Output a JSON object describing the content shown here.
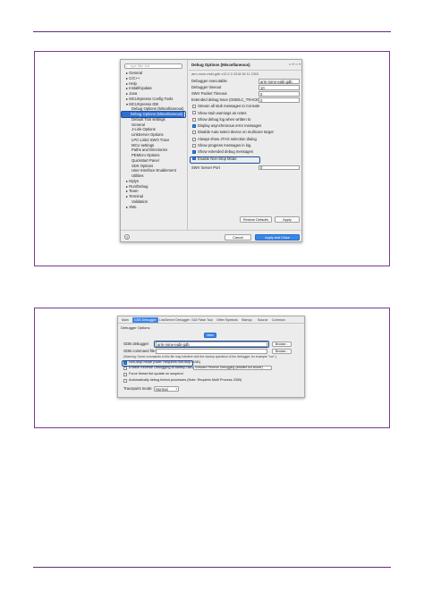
{
  "prefs": {
    "filter_placeholder": "type filter text",
    "tree": [
      {
        "label": "▸ General",
        "indent": 0,
        "selected": false
      },
      {
        "label": "▸ C/C++",
        "indent": 0,
        "selected": false
      },
      {
        "label": "▸ Help",
        "indent": 0,
        "selected": false
      },
      {
        "label": "▸ Install/Update",
        "indent": 0,
        "selected": false
      },
      {
        "label": "▸ Java",
        "indent": 0,
        "selected": false
      },
      {
        "label": "▸ MCUXpresso Config Tools",
        "indent": 0,
        "selected": false
      },
      {
        "label": "▾ MCUXpresso IDE",
        "indent": 0,
        "selected": false
      },
      {
        "label": "Debug Options (Miscellaneous)",
        "indent": 1,
        "selected": false
      },
      {
        "label": "Debug Options (Miscellaneous)",
        "indent": 1,
        "selected": true
      },
      {
        "label": "Default Tool settings",
        "indent": 1,
        "selected": false
      },
      {
        "label": "General",
        "indent": 1,
        "selected": false
      },
      {
        "label": "J-Link Options",
        "indent": 1,
        "selected": false
      },
      {
        "label": "LinkServer Options",
        "indent": 1,
        "selected": false
      },
      {
        "label": "LPC-Link2 SWO Trace",
        "indent": 1,
        "selected": false
      },
      {
        "label": "MCU settings",
        "indent": 1,
        "selected": false
      },
      {
        "label": "Paths and Directories",
        "indent": 1,
        "selected": false
      },
      {
        "label": "PEMicro Options",
        "indent": 1,
        "selected": false
      },
      {
        "label": "Quickstart Panel",
        "indent": 1,
        "selected": false
      },
      {
        "label": "SDK Options",
        "indent": 1,
        "selected": false
      },
      {
        "label": "User Interface Enablement",
        "indent": 1,
        "selected": false
      },
      {
        "label": "Utilities",
        "indent": 1,
        "selected": false
      },
      {
        "label": "▸ Mylyn",
        "indent": 0,
        "selected": false
      },
      {
        "label": "▸ Run/Debug",
        "indent": 0,
        "selected": false
      },
      {
        "label": "▸ Team",
        "indent": 0,
        "selected": false
      },
      {
        "label": "▸ Terminal",
        "indent": 0,
        "selected": false
      },
      {
        "label": "Validation",
        "indent": 1,
        "selected": false
      },
      {
        "label": "▸ XML",
        "indent": 0,
        "selected": false
      }
    ],
    "panel_title": "Debug Options (Miscellaneous)",
    "nav_glyphs": "⇦ ▾ ⇨ ▾",
    "subtitle": "arm-none-eabi-gdb v10.2.0 2018 06 11 2303",
    "fields": [
      {
        "label": "Debugger executable",
        "value": "arm-none-eabi-gdb"
      },
      {
        "label": "Debugger timeout",
        "value": "10"
      },
      {
        "label": "SWV Packet Timeout",
        "value": "0"
      },
      {
        "label": "Extended debug trace (0GB/LC_TRACE)",
        "value": "0"
      }
    ],
    "checks": [
      {
        "label": "Stream all stub messages to Console",
        "checked": false
      },
      {
        "label": "Show stub warnings as notes",
        "checked": false
      },
      {
        "label": "Show debug log when written to",
        "checked": false
      },
      {
        "label": "Display asynchronous error messages",
        "checked": true
      },
      {
        "label": "Disable Auto select device on multicore target",
        "checked": false
      },
      {
        "label": "Always show JTAG selection dialog",
        "checked": false
      },
      {
        "label": "Show progress messages in log",
        "checked": false
      },
      {
        "label": "Show extended debug messages",
        "checked": true
      },
      {
        "label": "Enable Non-Stop Mode",
        "checked": true
      }
    ],
    "server_port_label": "SWV Server Port",
    "server_port_value": "0",
    "restore_defaults": "Restore Defaults",
    "apply": "Apply",
    "cancel": "Cancel",
    "apply_close": "Apply and Close"
  },
  "launch": {
    "tabs": [
      "Main",
      "GDB Debugger",
      "LinkServer Debugger",
      "GUI Flash Tool",
      "Other Symbols",
      "Startup",
      "Source",
      "Common"
    ],
    "selected_tab": 1,
    "section_title": "Debugger Options",
    "main_button": "Main",
    "gdb_debugger_label": "GDB debugger:",
    "gdb_debugger_value": "arm-none-eabi-gdb",
    "gdb_command_label": "GDB command file:",
    "browse": "Browse...",
    "warning": "(Warning: Some commands in this file may interfere with the startup operation of the debugger, for example \"run\".)",
    "checks": [
      {
        "label": "Non-stop mode (Note: Requires non-stop GDB)",
        "checked": true
      },
      {
        "label": "Enable Reverse Debugging at startup using:",
        "checked": false
      },
      {
        "label": "Force thread list update on suspend",
        "checked": false
      },
      {
        "label": "Automatically debug forked processes (Note: Requires Multi Process GDB)",
        "checked": false
      }
    ],
    "reverse_option": "Software Reverse Debugging (detailed but slower)",
    "tracepoint_label": "Tracepoint mode:",
    "tracepoint_value": "Normal"
  }
}
